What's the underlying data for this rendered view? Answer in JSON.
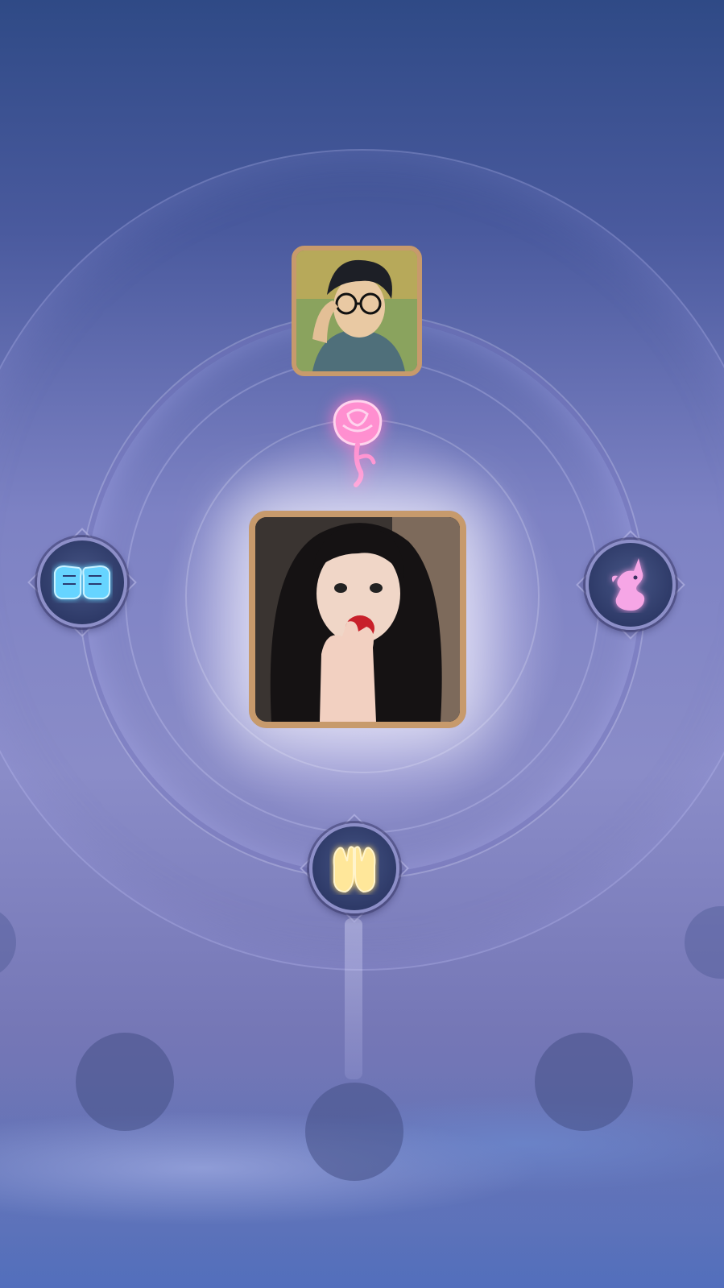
{
  "screen": {
    "theme_colors": {
      "frame_gold": "#c79a6c",
      "badge_ring": "#8d8fc8",
      "rose_pink": "#ff8fd0",
      "fist_blue": "#66d4ff",
      "hands_gold": "#ffe79a",
      "unicorn_pink": "#f6a6e6"
    }
  },
  "relationship": {
    "top_avatar": {
      "type": "user-avatar",
      "subject": "anime-character"
    },
    "center_avatar": {
      "type": "user-avatar",
      "subject": "photo"
    },
    "link_icon": "rose-icon"
  },
  "badges": [
    {
      "position": "left",
      "icon": "fist-bump-icon"
    },
    {
      "position": "right",
      "icon": "unicorn-icon"
    },
    {
      "position": "bottom",
      "icon": "clapping-hands-icon"
    }
  ],
  "empty_slots": [
    {
      "position": "bottom-left"
    },
    {
      "position": "bottom-center"
    },
    {
      "position": "bottom-right"
    }
  ]
}
